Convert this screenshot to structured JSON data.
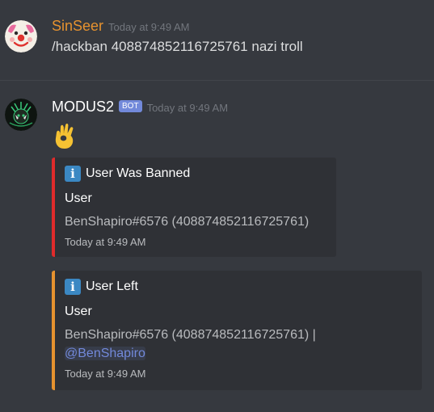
{
  "messages": [
    {
      "author": "SinSeer",
      "author_color": "#e6922f",
      "timestamp": "Today at 9:49 AM",
      "content": "/hackban 408874852116725761 nazi troll"
    },
    {
      "author": "MODUS2",
      "author_color": "#ffffff",
      "bot_tag": "BOT",
      "timestamp": "Today at 9:49 AM",
      "emoji": "ok-hand-emoji",
      "embeds": [
        {
          "color": "#e02b2b",
          "icon": "info-icon",
          "icon_glyph": "i",
          "title": "User Was Banned",
          "field_name": "User",
          "field_value": "BenShapiro#6576 (408874852116725761)",
          "footer": "Today at 9:49 AM"
        },
        {
          "color": "#e6922f",
          "icon": "info-icon",
          "icon_glyph": "i",
          "title": "User Left",
          "field_name": "User",
          "field_value": "BenShapiro#6576 (408874852116725761) |",
          "mention": "@BenShapiro",
          "footer": "Today at 9:49 AM"
        }
      ]
    }
  ]
}
